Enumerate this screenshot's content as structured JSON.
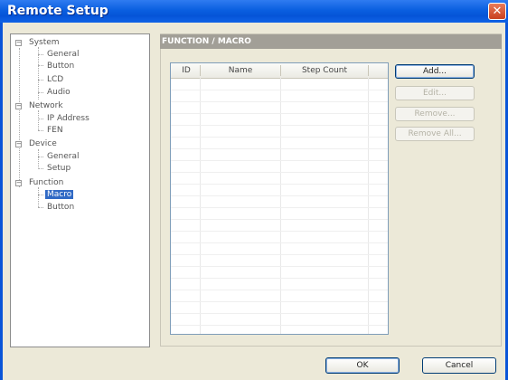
{
  "window": {
    "title": "Remote Setup",
    "close_glyph": "✕"
  },
  "tree": [
    {
      "label": "System",
      "level": 0,
      "expander": "−"
    },
    {
      "label": "General",
      "level": 1
    },
    {
      "label": "Button",
      "level": 1
    },
    {
      "label": "LCD",
      "level": 1
    },
    {
      "label": "Audio",
      "level": 1
    },
    {
      "label": "Network",
      "level": 0,
      "expander": "−"
    },
    {
      "label": "IP Address",
      "level": 1
    },
    {
      "label": "FEN",
      "level": 1
    },
    {
      "label": "Device",
      "level": 0,
      "expander": "−"
    },
    {
      "label": "General",
      "level": 1
    },
    {
      "label": "Setup",
      "level": 1
    },
    {
      "label": "Function",
      "level": 0,
      "expander": "−"
    },
    {
      "label": "Macro",
      "level": 1,
      "selected": true
    },
    {
      "label": "Button",
      "level": 1
    }
  ],
  "panel": {
    "header": "FUNCTION / MACRO"
  },
  "table": {
    "columns": [
      "ID",
      "Name",
      "Step Count"
    ],
    "rows": []
  },
  "actions": {
    "add": "Add...",
    "edit": "Edit...",
    "remove": "Remove...",
    "remove_all": "Remove All..."
  },
  "footer": {
    "ok": "OK",
    "cancel": "Cancel"
  },
  "colors": {
    "titlebar": "#0554d8",
    "selection": "#316ac5",
    "panel_header": "#a29f97"
  }
}
